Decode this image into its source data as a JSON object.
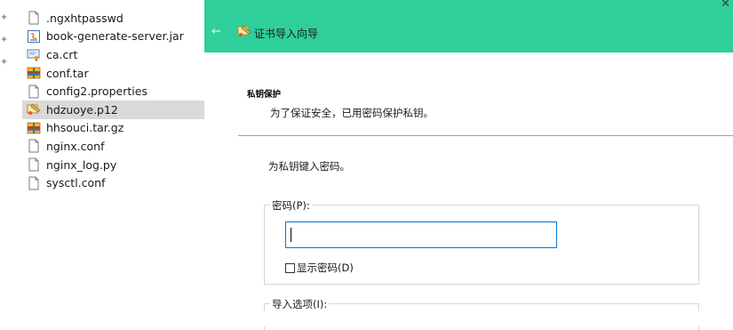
{
  "explorer": {
    "pins": [
      "✦",
      "✦",
      "✦"
    ],
    "files": [
      {
        "name": ".ngxhtpasswd",
        "icon": "blank-file-icon",
        "selected": false
      },
      {
        "name": "book-generate-server.jar",
        "icon": "jar-file-icon",
        "selected": false
      },
      {
        "name": "ca.crt",
        "icon": "certificate-file-icon",
        "selected": false
      },
      {
        "name": "conf.tar",
        "icon": "archive-file-icon",
        "selected": false
      },
      {
        "name": "config2.properties",
        "icon": "blank-file-icon",
        "selected": false
      },
      {
        "name": "hdzuoye.p12",
        "icon": "pfx-file-icon",
        "selected": true
      },
      {
        "name": "hhsouci.tar.gz",
        "icon": "archive-file-icon",
        "selected": false
      },
      {
        "name": "nginx.conf",
        "icon": "blank-file-icon",
        "selected": false
      },
      {
        "name": "nginx_log.py",
        "icon": "blank-file-icon",
        "selected": false
      },
      {
        "name": "sysctl.conf",
        "icon": "blank-file-icon",
        "selected": false
      }
    ]
  },
  "wizard": {
    "close_glyph": "✕",
    "back_glyph": "←",
    "title": "证书导入向导",
    "header_color": "#2fcf9b",
    "section_heading": "私钥保护",
    "section_subtitle": "为了保证安全，已用密码保护私钥。",
    "instruction": "为私钥键入密码。",
    "password_group_label": "密码(P):",
    "password_value": "",
    "show_password_label": "显示密码(D)",
    "show_password_checked": false,
    "import_options_label": "导入选项(I):"
  }
}
